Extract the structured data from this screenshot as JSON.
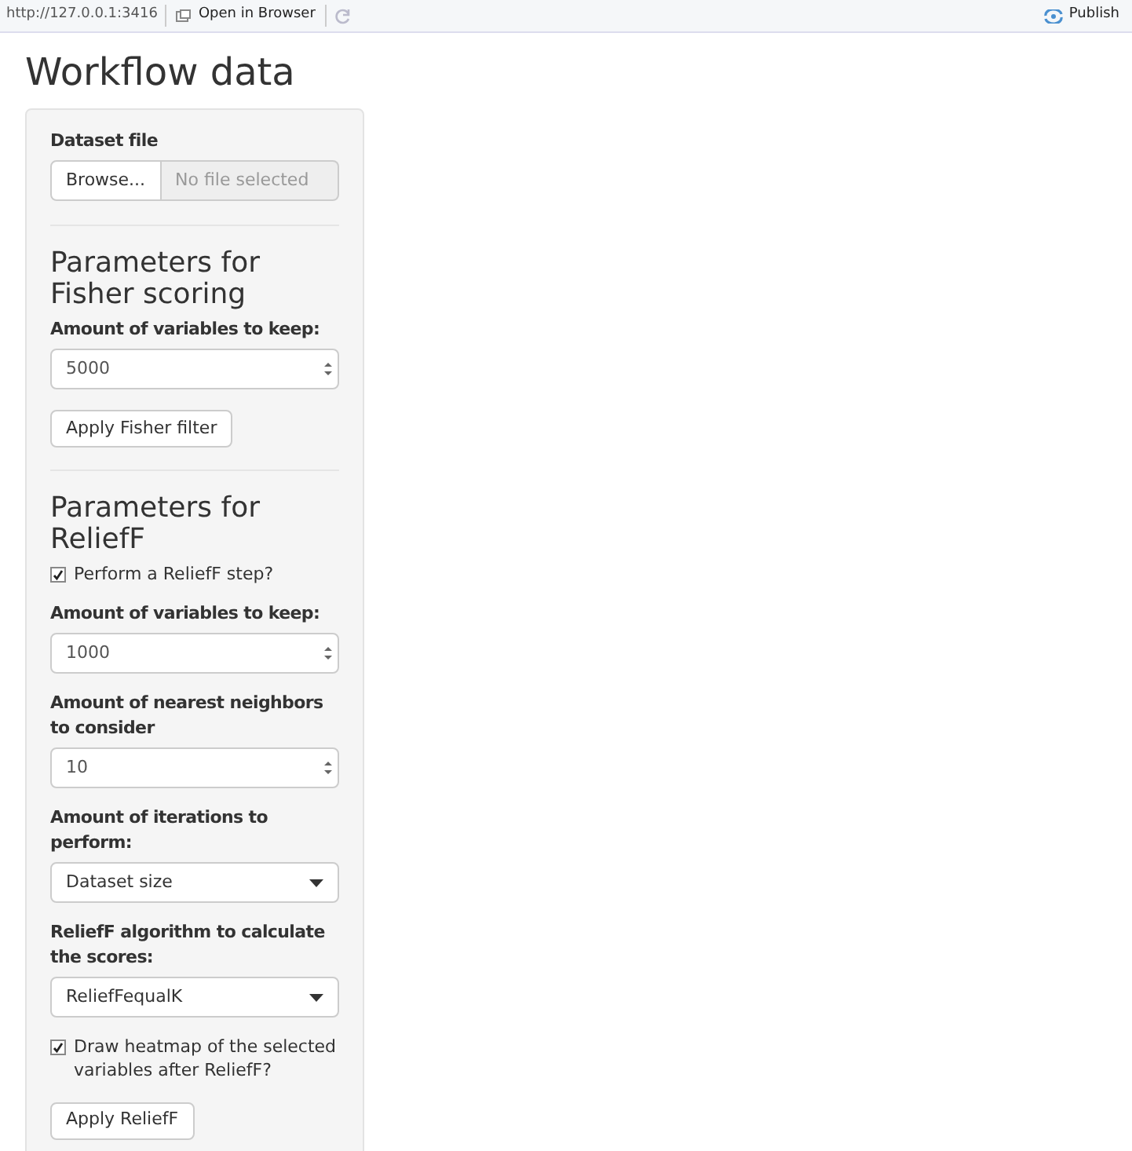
{
  "toolbar": {
    "url": "http://127.0.0.1:3416",
    "open_in_browser": "Open in Browser",
    "publish": "Publish"
  },
  "title": "Workflow data",
  "sidebar": {
    "items": [
      {
        "kind": "file",
        "label": "Dataset file",
        "button": "Browse...",
        "placeholder": "No file selected"
      },
      {
        "kind": "divider"
      },
      {
        "kind": "heading",
        "text": "Parameters for Fisher scoring"
      },
      {
        "kind": "number",
        "label": "Amount of variables to keep:",
        "value": "5000"
      },
      {
        "kind": "button",
        "text": "Apply Fisher filter"
      },
      {
        "kind": "divider"
      },
      {
        "kind": "heading",
        "text": "Parameters for ReliefF"
      },
      {
        "kind": "checkbox",
        "text": "Perform a ReliefF step?",
        "checked": true
      },
      {
        "kind": "number",
        "label": "Amount of variables to keep:",
        "value": "1000"
      },
      {
        "kind": "number",
        "label": "Amount of nearest neighbors to consider",
        "value": "10"
      },
      {
        "kind": "select",
        "label": "Amount of iterations to perform:",
        "value": "Dataset size"
      },
      {
        "kind": "select",
        "label": "ReliefF algorithm to calculate the scores:",
        "value": "ReliefFequalK"
      },
      {
        "kind": "checkbox",
        "text": "Draw heatmap of the selected variables after ReliefF?",
        "checked": true
      },
      {
        "kind": "button",
        "text": "Apply ReliefF"
      }
    ]
  }
}
